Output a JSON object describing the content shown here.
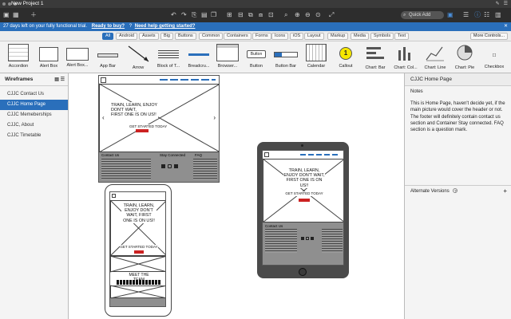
{
  "window": {
    "title": "New Project 1"
  },
  "toolbar": {
    "quick_add": "Quick Add"
  },
  "trial": {
    "text": "27 days left on your fully functional trial.",
    "buy": "Ready to buy?",
    "help": "Need help getting started?"
  },
  "categories": [
    "All",
    "Android",
    "Assets",
    "Big",
    "Buttons",
    "Common",
    "Containers",
    "Forms",
    "Icons",
    "iOS",
    "Layout",
    "Markup",
    "Media",
    "Symbols",
    "Text"
  ],
  "more_controls": "More Controls...",
  "library": [
    "Accordion",
    "Alert Box",
    "Alert Box...",
    "App Bar",
    "Arrow",
    "Block of T...",
    "Breadcru...",
    "Browser...",
    "Button",
    "Button Bar",
    "Calendar",
    "Callout",
    "Chart: Bar",
    "Chart: Col...",
    "Chart: Line",
    "Chart: Pie",
    "Checkbox"
  ],
  "library_button_text": "Button",
  "sidebar": {
    "title": "Wireframes",
    "items": [
      "CJJC Contact Us",
      "CJJC Home Page",
      "CJJC Memeberships",
      "CJJC, About",
      "CJJC Timetable"
    ]
  },
  "right_panel": {
    "title": "CJJC Home Page",
    "notes_label": "Notes",
    "notes": "This is Home Page, haven't decide yet, if the main picture would cover the header or not.  The footer  will definitely contain contact us section and  Container Stay connected. FAQ section is a question mark.",
    "alternate": "Alternate Versions",
    "alt_help": "?"
  },
  "desktop": {
    "hero_line1": "TRAIN, LEARN, ENJOY",
    "hero_line2": "DON'T WAIT,",
    "hero_line3": "FIRST ONE IS ON US!!",
    "cta": "GET STARTED TODAY",
    "footer_contact": "Contact Us",
    "footer_stay": "Stay Connected",
    "footer_faq": "FAQ"
  },
  "mobile": {
    "hero": "TRAIN, LEARN, ENJOY DON'T WAIT, FIRST ONE IS ON US!!",
    "cta": "GET STARTED TODAY",
    "team": "MEET THE TEAM"
  },
  "tablet": {
    "hero": "TRAIN, LEARN, ENJOY DON'T WAIT, FIRST ONE IS ON US!!",
    "cta": "GET STARTED TODAY",
    "footer_contact": "Contact Us"
  },
  "colors": {
    "accent": "#2a6fbb",
    "cta_red": "#cc2222"
  }
}
